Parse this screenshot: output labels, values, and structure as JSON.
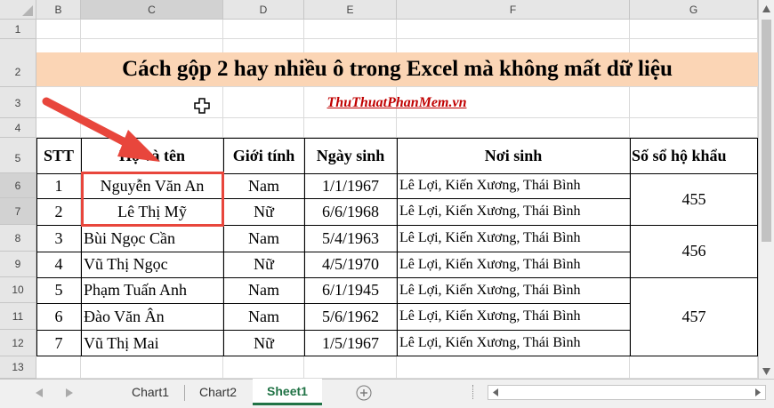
{
  "columns": [
    "B",
    "C",
    "D",
    "E",
    "F",
    "G"
  ],
  "rows": [
    "1",
    "2",
    "3",
    "4",
    "5",
    "6",
    "7",
    "8",
    "9",
    "10",
    "11",
    "12",
    "13"
  ],
  "title": "Cách gộp 2 hay nhiều ô trong Excel mà không mất dữ liệu",
  "link": "ThuThuatPhanMem.vn",
  "headers": {
    "stt": "STT",
    "name": "Họ và tên",
    "gender": "Giới tính",
    "dob": "Ngày sinh",
    "birthplace": "Nơi sinh",
    "household": "Số sổ hộ khẩu"
  },
  "records": [
    {
      "stt": "1",
      "name": "Nguyễn Văn An",
      "gender": "Nam",
      "dob": "1/1/1967",
      "birthplace": "Lê Lợi, Kiến Xương, Thái Bình"
    },
    {
      "stt": "2",
      "name": "Lê Thị Mỹ",
      "gender": "Nữ",
      "dob": "6/6/1968",
      "birthplace": "Lê Lợi, Kiến Xương, Thái Bình"
    },
    {
      "stt": "3",
      "name": "Bùi Ngọc Cần",
      "gender": "Nam",
      "dob": "5/4/1963",
      "birthplace": "Lê Lợi, Kiến Xương, Thái Bình"
    },
    {
      "stt": "4",
      "name": "Vũ Thị Ngọc",
      "gender": "Nữ",
      "dob": "4/5/1970",
      "birthplace": "Lê Lợi, Kiến Xương, Thái Bình"
    },
    {
      "stt": "5",
      "name": "Phạm Tuấn Anh",
      "gender": "Nam",
      "dob": "6/1/1945",
      "birthplace": "Lê Lợi, Kiến Xương, Thái Bình"
    },
    {
      "stt": "6",
      "name": "Đào Văn Ân",
      "gender": "Nam",
      "dob": "5/6/1962",
      "birthplace": "Lê Lợi, Kiến Xương, Thái Bình"
    },
    {
      "stt": "7",
      "name": "Vũ Thị Mai",
      "gender": "Nữ",
      "dob": "1/5/1967",
      "birthplace": "Lê Lợi, Kiến Xương, Thái Bình"
    }
  ],
  "household_groups": [
    "455",
    "456",
    "457"
  ],
  "sheet_tabs": [
    "Chart1",
    "Chart2",
    "Sheet1"
  ],
  "active_tab": "Sheet1",
  "colors": {
    "title_band": "#fbd5b5",
    "link": "#c00000",
    "arrow": "#e8463c",
    "selection_border": "#e8463c",
    "active_tab_text": "#217346"
  }
}
